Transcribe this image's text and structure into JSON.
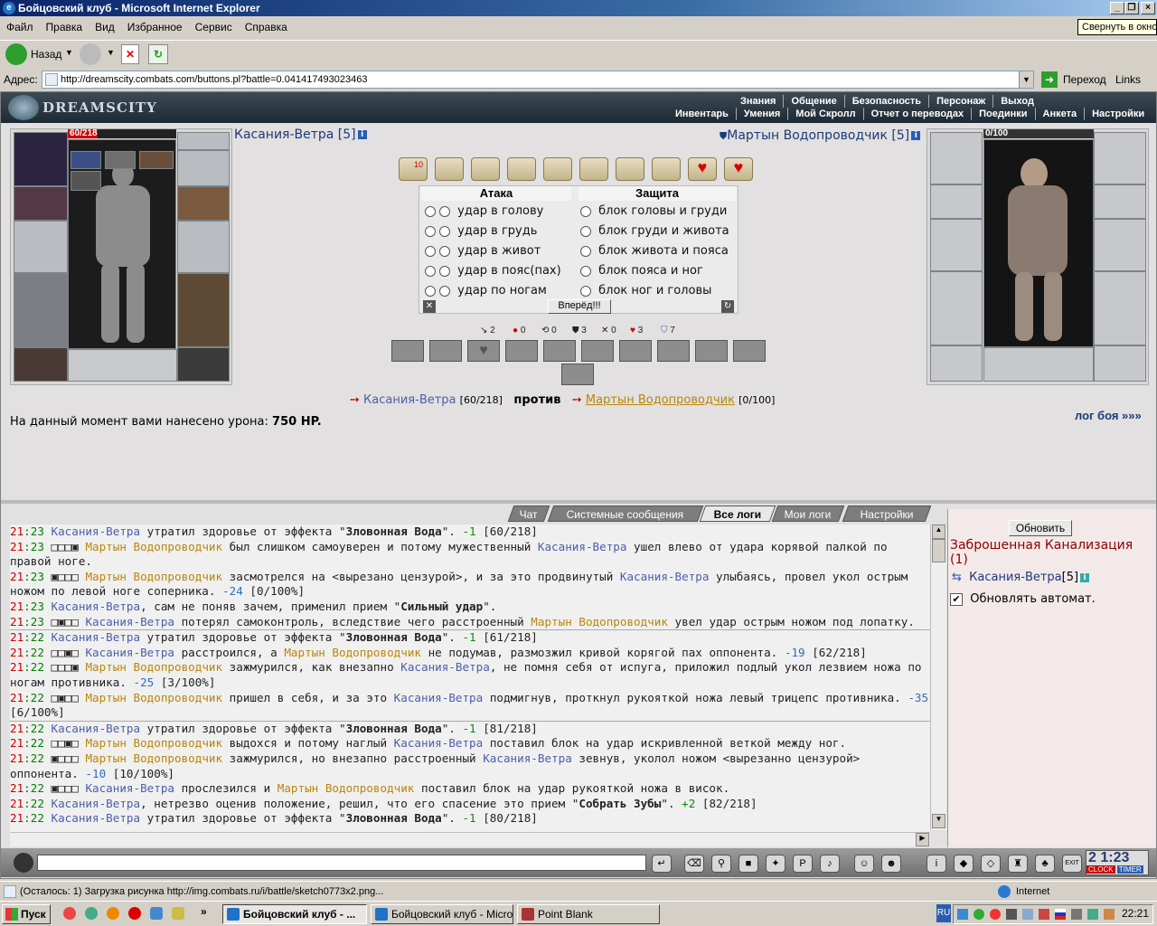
{
  "window": {
    "title": "Бойцовский клуб - Microsoft Internet Explorer",
    "tooltip": "Свернуть в окно"
  },
  "menu": [
    "Файл",
    "Правка",
    "Вид",
    "Избранное",
    "Сервис",
    "Справка"
  ],
  "toolbar": {
    "back_label": "Назад"
  },
  "address": {
    "label": "Адрес:",
    "url": "http://dreamscity.combats.com/buttons.pl?battle=0.041417493023463",
    "go_label": "Переход",
    "links_label": "Links"
  },
  "site": {
    "logo": "DREAMSCITY",
    "nav_top": [
      "Знания",
      "Общение",
      "Безопасность",
      "Персонаж",
      "Выход"
    ],
    "nav_bottom": [
      "Инвентарь",
      "Умения",
      "Мой Скролл",
      "Отчет о переводах",
      "Поединки",
      "Анкета",
      "Настройки"
    ]
  },
  "player": {
    "name": "Касания-Ветра [5]",
    "hp": "60/218",
    "hp_fraction": 0.275
  },
  "enemy": {
    "name": "Мартын Водопроводчик [5]",
    "hp": "0/100",
    "hp_fraction": 0.0
  },
  "combat": {
    "attack_header": "Атака",
    "defense_header": "Защита",
    "attacks": [
      "удар в голову",
      "удар в грудь",
      "удар в живот",
      "удар в пояс(пах)",
      "удар по ногам"
    ],
    "blocks": [
      "блок головы и груди",
      "блок груди и живота",
      "блок живота и пояса",
      "блок пояса и ног",
      "блок ног и головы"
    ],
    "forward_button": "Вперёд!!!",
    "scroll_counter": "10",
    "stats": [
      "2",
      "0",
      "0",
      "3",
      "0",
      "3",
      "7"
    ]
  },
  "versus": {
    "player_name": "Касания-Ветра",
    "player_hp": "[60/218]",
    "vs_label": "против",
    "enemy_name": "Мартын Водопроводчик",
    "enemy_hp": "[0/100]",
    "damage_prefix": "На данный момент вами нанесено урона:",
    "damage_value": "750 HP.",
    "battle_log_link": "лог боя »»»"
  },
  "log_tabs": [
    "Чат",
    "Системные сообщения",
    "Все логи",
    "Мои логи",
    "Настройки"
  ],
  "log_lines": [
    {
      "time": "21:23",
      "sep": false,
      "parts": [
        {
          "c": "p1",
          "t": "Касания-Ветра"
        },
        {
          "c": "",
          "t": " утратил здоровье от эффекта \""
        },
        {
          "c": "b",
          "t": "Зловонная Вода"
        },
        {
          "c": "",
          "t": "\". "
        },
        {
          "c": "heal",
          "t": "-1"
        },
        {
          "c": "",
          "t": " [60/218]"
        }
      ]
    },
    {
      "time": "21:23",
      "sep": false,
      "parts": [
        {
          "c": "",
          "t": "□□□▣ "
        },
        {
          "c": "p2",
          "t": "Мартын Водопроводчик"
        },
        {
          "c": "",
          "t": " был слишком самоуверен и потому мужественный "
        },
        {
          "c": "p1",
          "t": "Касания-Ветра"
        },
        {
          "c": "",
          "t": " ушел влево от удара корявой палкой по правой ноге."
        }
      ]
    },
    {
      "time": "21:23",
      "sep": false,
      "parts": [
        {
          "c": "",
          "t": "▣□□□ "
        },
        {
          "c": "p2",
          "t": "Мартын Водопроводчик"
        },
        {
          "c": "",
          "t": " засмотрелся на <вырезано цензурой>, и за это продвинутый "
        },
        {
          "c": "p1",
          "t": "Касания-Ветра"
        },
        {
          "c": "",
          "t": " улыбаясь, провел укол острым ножом по левой ноге соперника. "
        },
        {
          "c": "dmg",
          "t": "-24"
        },
        {
          "c": "",
          "t": " [0/100%]"
        }
      ]
    },
    {
      "time": "21:23",
      "sep": false,
      "parts": [
        {
          "c": "p1",
          "t": "Касания-Ветра"
        },
        {
          "c": "",
          "t": ", сам не поняв зачем, применил прием \""
        },
        {
          "c": "b",
          "t": "Сильный удар"
        },
        {
          "c": "",
          "t": "\"."
        }
      ]
    },
    {
      "time": "21:23",
      "sep": false,
      "parts": [
        {
          "c": "",
          "t": "□▣□□ "
        },
        {
          "c": "p1",
          "t": "Касания-Ветра"
        },
        {
          "c": "",
          "t": " потерял самоконтроль, вследствие чего расстроенный "
        },
        {
          "c": "p2",
          "t": "Мартын Водопроводчик"
        },
        {
          "c": "",
          "t": " увел удар острым ножом под лопатку."
        }
      ]
    },
    {
      "time": "21:22",
      "sep": true,
      "parts": [
        {
          "c": "p1",
          "t": "Касания-Ветра"
        },
        {
          "c": "",
          "t": " утратил здоровье от эффекта \""
        },
        {
          "c": "b",
          "t": "Зловонная Вода"
        },
        {
          "c": "",
          "t": "\". "
        },
        {
          "c": "heal",
          "t": "-1"
        },
        {
          "c": "",
          "t": " [61/218]"
        }
      ]
    },
    {
      "time": "21:22",
      "sep": false,
      "parts": [
        {
          "c": "",
          "t": "□□▣□ "
        },
        {
          "c": "p1",
          "t": "Касания-Ветра"
        },
        {
          "c": "",
          "t": " расстроился, а "
        },
        {
          "c": "p2",
          "t": "Мартын Водопроводчик"
        },
        {
          "c": "",
          "t": " не подумав, размозжил кривой корягой пах оппонента. "
        },
        {
          "c": "dmg",
          "t": "-19"
        },
        {
          "c": "",
          "t": " [62/218]"
        }
      ]
    },
    {
      "time": "21:22",
      "sep": false,
      "parts": [
        {
          "c": "",
          "t": "□□□▣ "
        },
        {
          "c": "p2",
          "t": "Мартын Водопроводчик"
        },
        {
          "c": "",
          "t": " зажмурился, как внезапно "
        },
        {
          "c": "p1",
          "t": "Касания-Ветра"
        },
        {
          "c": "",
          "t": ", не помня себя от испуга, приложил подлый укол лезвием ножа по ногам противника. "
        },
        {
          "c": "dmg",
          "t": "-25"
        },
        {
          "c": "",
          "t": " [3/100%]"
        }
      ]
    },
    {
      "time": "21:22",
      "sep": false,
      "parts": [
        {
          "c": "",
          "t": "□▣□□ "
        },
        {
          "c": "p2",
          "t": "Мартын Водопроводчик"
        },
        {
          "c": "",
          "t": " пришел в себя, и за это "
        },
        {
          "c": "p1",
          "t": "Касания-Ветра"
        },
        {
          "c": "",
          "t": " подмигнув, проткнул рукояткой ножа левый трицепс противника. "
        },
        {
          "c": "dmg",
          "t": "-35"
        },
        {
          "c": "",
          "t": " [6/100%]"
        }
      ]
    },
    {
      "time": "21:22",
      "sep": true,
      "parts": [
        {
          "c": "p1",
          "t": "Касания-Ветра"
        },
        {
          "c": "",
          "t": " утратил здоровье от эффекта \""
        },
        {
          "c": "b",
          "t": "Зловонная Вода"
        },
        {
          "c": "",
          "t": "\". "
        },
        {
          "c": "heal",
          "t": "-1"
        },
        {
          "c": "",
          "t": " [81/218]"
        }
      ]
    },
    {
      "time": "21:22",
      "sep": false,
      "parts": [
        {
          "c": "",
          "t": "□□▣□ "
        },
        {
          "c": "p2",
          "t": "Мартын Водопроводчик"
        },
        {
          "c": "",
          "t": " выдохся и потому наглый "
        },
        {
          "c": "p1",
          "t": "Касания-Ветра"
        },
        {
          "c": "",
          "t": " поставил блок на удар искривленной веткой между ног."
        }
      ]
    },
    {
      "time": "21:22",
      "sep": false,
      "parts": [
        {
          "c": "",
          "t": "▣□□□ "
        },
        {
          "c": "p2",
          "t": "Мартын Водопроводчик"
        },
        {
          "c": "",
          "t": " зажмурился, но внезапно расстроенный "
        },
        {
          "c": "p1",
          "t": "Касания-Ветра"
        },
        {
          "c": "",
          "t": " зевнув, уколол ножом <вырезанно цензурой> оппонента. "
        },
        {
          "c": "dmg",
          "t": "-10"
        },
        {
          "c": "",
          "t": " [10/100%]"
        }
      ]
    },
    {
      "time": "21:22",
      "sep": false,
      "parts": [
        {
          "c": "",
          "t": "▣□□□ "
        },
        {
          "c": "p1",
          "t": "Касания-Ветра"
        },
        {
          "c": "",
          "t": " прослезился и "
        },
        {
          "c": "p2",
          "t": "Мартын Водопроводчик"
        },
        {
          "c": "",
          "t": " поставил блок на удар рукояткой ножа в висок."
        }
      ]
    },
    {
      "time": "21:22",
      "sep": false,
      "parts": [
        {
          "c": "p1",
          "t": "Касания-Ветра"
        },
        {
          "c": "",
          "t": ", нетрезво оценив положение, решил, что его спасение это прием \""
        },
        {
          "c": "b",
          "t": "Собрать Зубы"
        },
        {
          "c": "",
          "t": "\". "
        },
        {
          "c": "heal",
          "t": "+2"
        },
        {
          "c": "",
          "t": " [82/218]"
        }
      ]
    },
    {
      "time": "21:22",
      "sep": false,
      "parts": [
        {
          "c": "p1",
          "t": "Касания-Ветра"
        },
        {
          "c": "",
          "t": " утратил здоровье от эффекта \""
        },
        {
          "c": "b",
          "t": "Зловонная Вода"
        },
        {
          "c": "",
          "t": "\". "
        },
        {
          "c": "heal",
          "t": "-1"
        },
        {
          "c": "",
          "t": " [80/218]"
        }
      ]
    }
  ],
  "right_panel": {
    "refresh_button": "Обновить",
    "location": "Заброшенная Канализация (1)",
    "member_name": "Касания-Ветра",
    "member_level": "[5]",
    "auto_refresh_label": "Обновлять автомат."
  },
  "status": {
    "text": "(Осталось: 1) Загрузка рисунка http://img.combats.ru/i/battle/sketch0773x2.png...",
    "zone": "Internet"
  },
  "clock": {
    "time": "2 1:23",
    "clock_label": "CLOCK",
    "timer_label": "TIMER",
    "exit_label": "EXIT"
  },
  "taskbar": {
    "start": "Пуск",
    "tasks": [
      "Бойцовский клуб - ...",
      "Бойцовский клуб - Micro...",
      "Point Blank"
    ],
    "lang": "RU",
    "time": "22:21"
  }
}
